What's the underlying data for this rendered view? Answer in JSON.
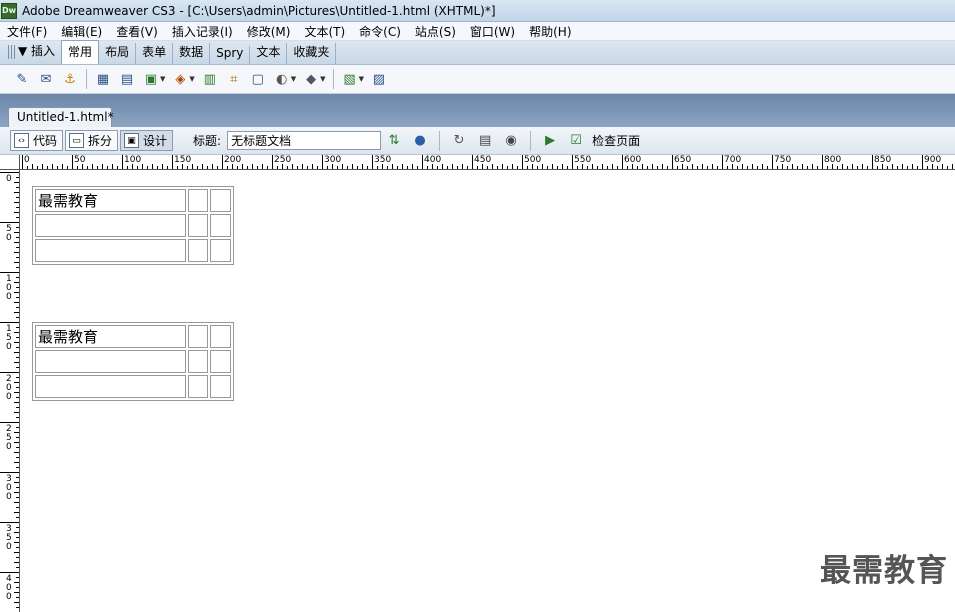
{
  "window": {
    "app_icon": "Dw",
    "title": "Adobe Dreamweaver CS3 - [C:\\Users\\admin\\Pictures\\Untitled-1.html (XHTML)*]"
  },
  "menu": [
    "文件(F)",
    "编辑(E)",
    "查看(V)",
    "插入记录(I)",
    "修改(M)",
    "文本(T)",
    "命令(C)",
    "站点(S)",
    "窗口(W)",
    "帮助(H)"
  ],
  "insert_panel": {
    "title": "▼ 插入",
    "tabs": [
      "常用",
      "布局",
      "表单",
      "数据",
      "Spry",
      "文本",
      "收藏夹"
    ],
    "active_tab": "常用"
  },
  "toolbar_icons": [
    "hyperlink-icon",
    "email-link-icon",
    "named-anchor-icon",
    "table-icon",
    "div-icon",
    "image-icon",
    "media-icon",
    "date-icon",
    "server-include-icon",
    "comment-icon",
    "head-icon",
    "script-icon",
    "template-icon",
    "tag-chooser-icon"
  ],
  "document": {
    "tab_label": "Untitled-1.html*",
    "view_buttons": [
      "代码",
      "拆分",
      "设计"
    ],
    "active_view": "设计",
    "title_label": "标题:",
    "title_value": "无标题文档",
    "check_page_label": "检查页面"
  },
  "ruler": {
    "h_labels": [
      "0",
      "50",
      "100",
      "150",
      "200",
      "250",
      "300",
      "350",
      "400",
      "450",
      "500",
      "550",
      "600",
      "650",
      "700",
      "750",
      "800",
      "850",
      "900"
    ],
    "v_labels": [
      "0",
      "50",
      "100",
      "150",
      "200",
      "250",
      "300",
      "350",
      "400"
    ]
  },
  "tables": [
    {
      "rows": [
        [
          "最需教育",
          "",
          ""
        ],
        [
          "",
          "",
          ""
        ],
        [
          "",
          "",
          ""
        ]
      ]
    },
    {
      "rows": [
        [
          "最需教育",
          "",
          ""
        ],
        [
          "",
          "",
          ""
        ],
        [
          "",
          "",
          ""
        ]
      ]
    }
  ],
  "watermark": "最需教育"
}
